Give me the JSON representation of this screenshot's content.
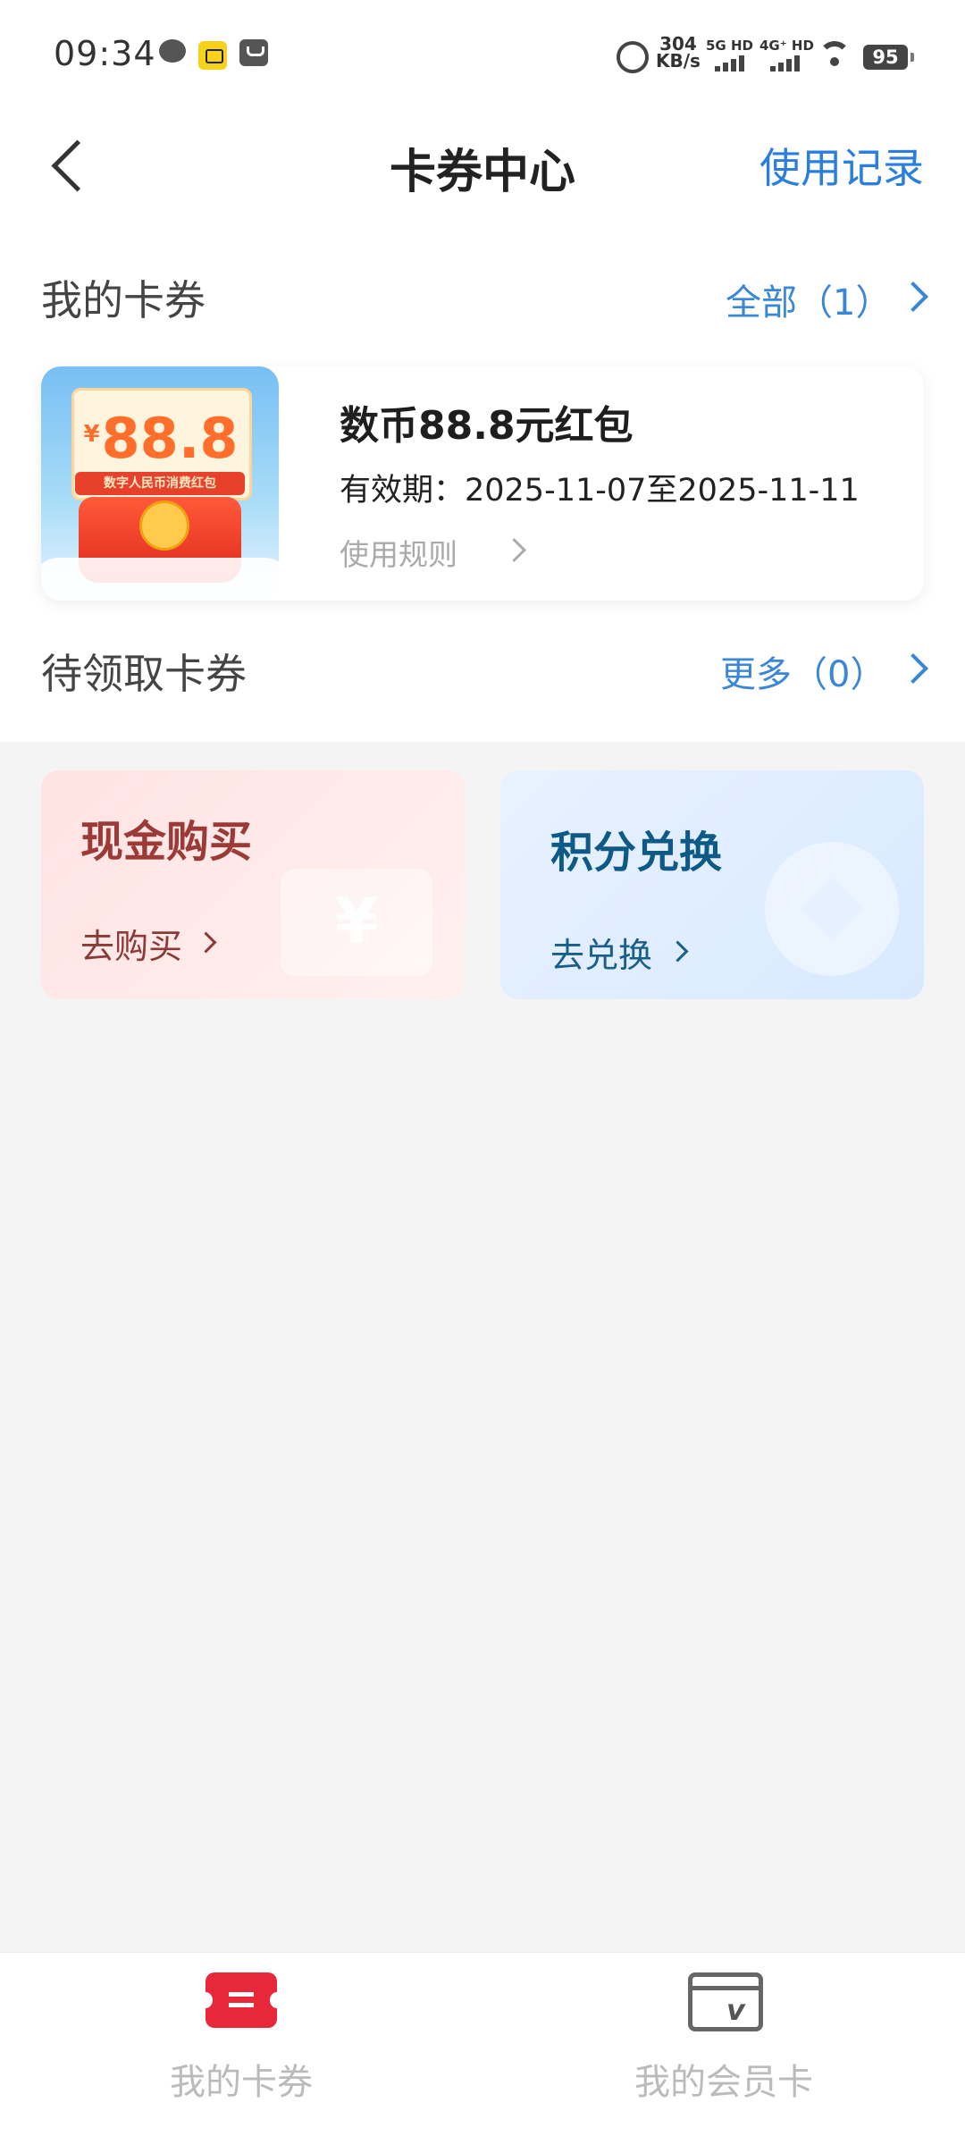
{
  "status_bar": {
    "time": "09:34",
    "network_speed_value": "304",
    "network_speed_unit": "KB/s",
    "sim1": "5G HD",
    "sim2": "4G⁺ HD",
    "battery": "95",
    "icons": [
      "chat-icon",
      "app-icon",
      "mail-icon",
      "alarm-icon",
      "signal-icon",
      "wifi-icon",
      "battery-icon"
    ]
  },
  "header": {
    "title": "卡券中心",
    "record_link": "使用记录"
  },
  "my_coupons": {
    "title": "我的卡券",
    "link": "全部（1）",
    "items": [
      {
        "image_amount": "88.8",
        "image_currency": "¥",
        "image_ribbon": "数字人民币消费红包",
        "name": "数币88.8元红包",
        "validity": "有效期：2025-11-07至2025-11-11",
        "rules": "使用规则"
      }
    ]
  },
  "pending_coupons": {
    "title": "待领取卡券",
    "link": "更多（0）"
  },
  "actions": {
    "cash": {
      "title": "现金购买",
      "link": "去购买"
    },
    "points": {
      "title": "积分兑换",
      "link": "去兑换"
    }
  },
  "bottom_nav": {
    "items": [
      {
        "label": "我的卡券",
        "icon": "coupon-icon",
        "active": true
      },
      {
        "label": "我的会员卡",
        "icon": "member-card-icon",
        "active": false
      }
    ]
  },
  "colors": {
    "accent": "#2a7ee0",
    "coupon_icon": "#e8283a",
    "cash_title": "#9b3a36",
    "points_title": "#0e5a86"
  }
}
